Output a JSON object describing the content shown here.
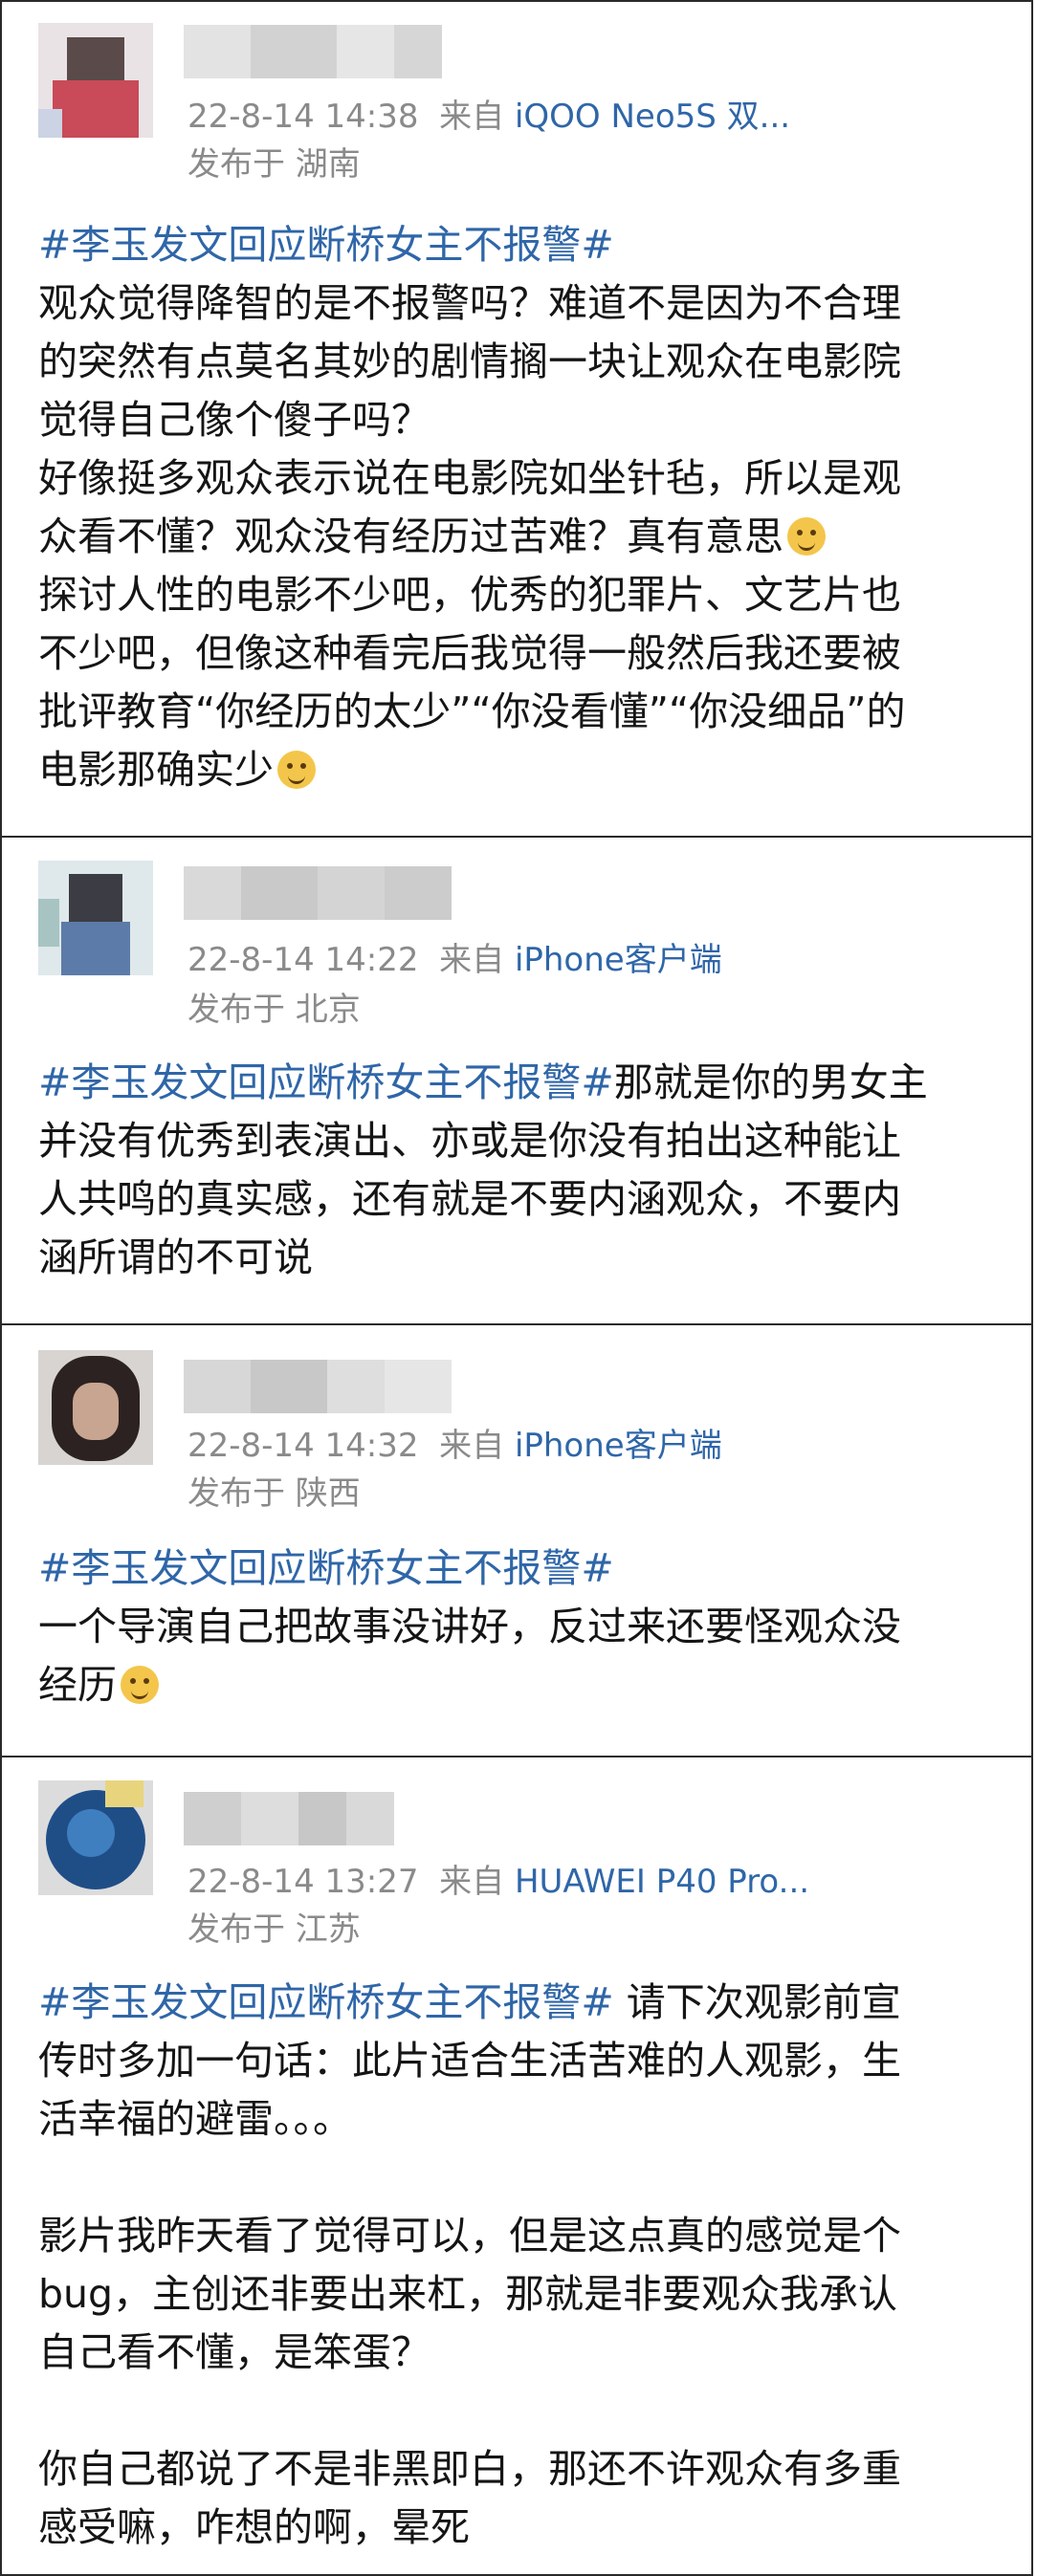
{
  "posts": [
    {
      "time": "22-8-14 14:38",
      "source_prefix": "来自",
      "source": "iQOO Neo5S 双...",
      "location": "发布于 湖南",
      "hashtag": "#李玉发文回应断桥女主不报警#",
      "lines": [
        "观众觉得降智的是不报警吗？难道不是因为不合理",
        "的突然有点莫名其妙的剧情搁一块让观众在电影院",
        "觉得自己像个傻子吗？",
        "好像挺多观众表示说在电影院如坐针毡，所以是观",
        "众看不懂？观众没有经历过苦难？真有意思",
        "探讨人性的电影不少吧，优秀的犯罪片、文艺片也",
        "不少吧，但像这种看完后我觉得一般然后我还要被",
        "批评教育“你经历的太少”“你没看懂”“你没细品”的",
        "电影那确实少"
      ]
    },
    {
      "time": "22-8-14 14:22",
      "source_prefix": "来自",
      "source": "iPhone客户端",
      "location": "发布于 北京",
      "hashtag": "#李玉发文回应断桥女主不报警#",
      "first_tail": "那就是你的男女主",
      "lines": [
        "并没有优秀到表演出、亦或是你没有拍出这种能让",
        "人共鸣的真实感，还有就是不要内涵观众，不要内",
        "涵所谓的不可说"
      ]
    },
    {
      "time": "22-8-14 14:32",
      "source_prefix": "来自",
      "source": "iPhone客户端",
      "location": "发布于 陕西",
      "hashtag": "#李玉发文回应断桥女主不报警#",
      "lines": [
        "一个导演自己把故事没讲好，反过来还要怪观众没",
        "经历"
      ]
    },
    {
      "time": "22-8-14 13:27",
      "source_prefix": "来自",
      "source": "HUAWEI P40 Pro...",
      "location": "发布于 江苏",
      "hashtag": "#李玉发文回应断桥女主不报警#",
      "first_tail": " 请下次观影前宣",
      "lines": [
        "传时多加一句话：此片适合生活苦难的人观影，生",
        "活幸福的避雷。。。",
        "",
        "影片我昨天看了觉得可以，但是这点真的感觉是个",
        "bug，主创还非要出来杠，那就是非要观众我承认",
        "自己看不懂，是笨蛋？",
        "",
        "你自己都说了不是非黑即白，那还不许观众有多重",
        "感受嘛，咋想的啊，晕死"
      ]
    }
  ]
}
